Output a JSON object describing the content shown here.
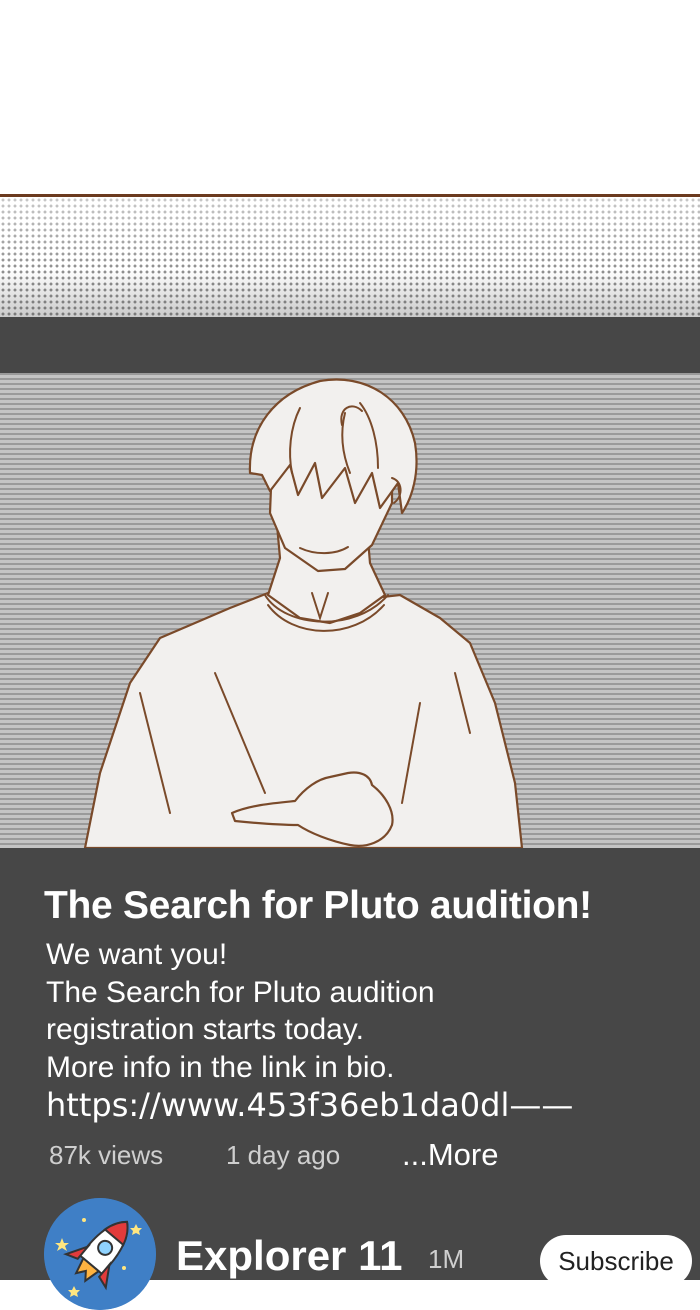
{
  "post": {
    "title": "The Search for Pluto audition!",
    "description": "We want you!\nThe Search for Pluto audition\nregistration starts today.\nMore info in the link in bio.",
    "link": "https://www.453f36eb1da0dl——",
    "views": "87k views",
    "posted": "1 day ago",
    "more_label": "...More"
  },
  "channel": {
    "name": "Explorer 11",
    "subscribers": "1M",
    "subscribe_label": "Subscribe",
    "avatar_icon": "rocket-icon"
  },
  "colors": {
    "panel_bg": "#474747",
    "border_brown": "#6b3a1f",
    "line_brown": "#7a4a2a"
  }
}
